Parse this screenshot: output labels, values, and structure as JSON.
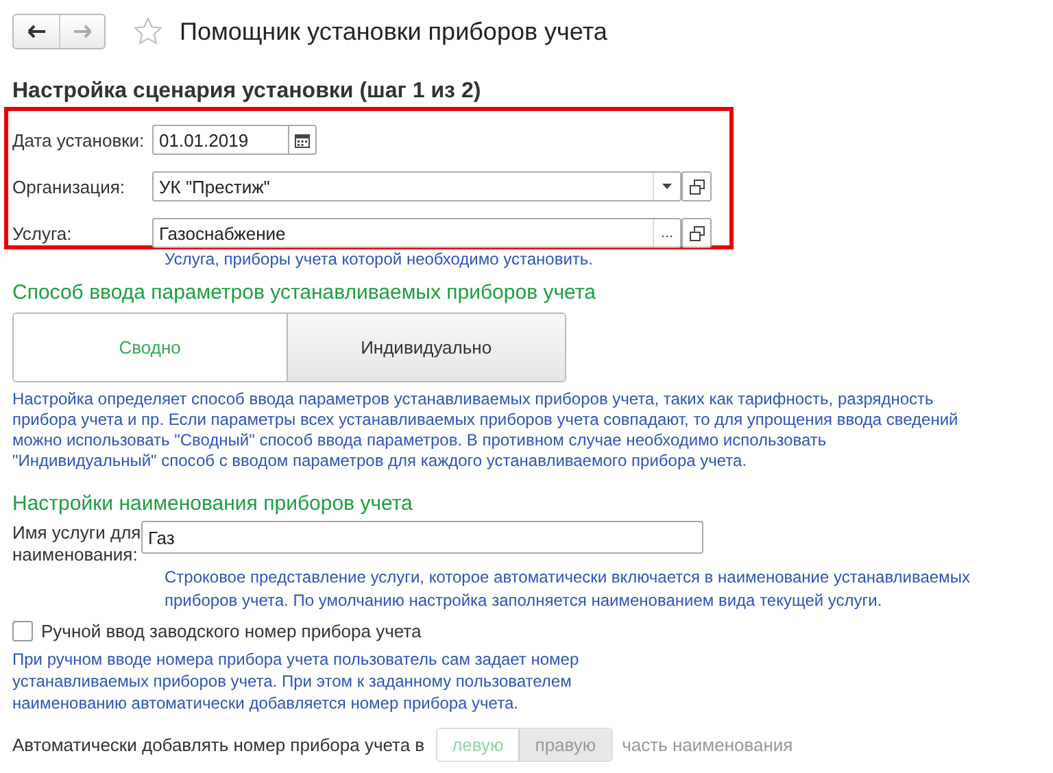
{
  "toolbar": {
    "back": {
      "disabled": false
    },
    "forward": {
      "disabled": true
    },
    "favorite": false,
    "title": "Помощник установки приборов учета"
  },
  "step_heading": "Настройка сценария установки (шаг 1 из 2)",
  "fields": [
    {
      "kind": "date",
      "label": "Дата установки:",
      "value": "01.01.2019"
    },
    {
      "kind": "select",
      "label": "Организация:",
      "value": "УК \"Престиж\""
    },
    {
      "kind": "choice",
      "label": "Услуга:",
      "value": "Газоснабжение",
      "choice_glyph": "..."
    }
  ],
  "service_hint": "Услуга, приборы учета которой необходимо установить.",
  "input_method": {
    "heading": "Способ ввода параметров устанавливаемых приборов учета",
    "options": [
      {
        "label": "Сводно",
        "selected": true
      },
      {
        "label": "Индивидуально",
        "selected": false
      }
    ],
    "description": "Настройка определяет способ ввода параметров устанавливаемых приборов учета, таких как тарифность, разрядность прибора учета и пр. Если параметры всех устанавливаемых приборов учета совпадают, то для упрощения ввода сведений можно использовать \"Сводный\" способ ввода параметров. В противном случае необходимо использовать \"Индивидуальный\" способ с вводом параметров для каждого устанавливаемого прибора учета."
  },
  "naming": {
    "heading": "Настройки наименования приборов учета",
    "name_label": "Имя услуги для наименования:",
    "name_value": "Газ",
    "name_hint": "Строковое представление услуги, которое автоматически включается в наименование устанавливаемых приборов учета. По умолчанию настройка заполняется наименованием вида текущей услуги.",
    "manual": {
      "label": "Ручной ввод заводского номер прибора учета",
      "checked": false
    },
    "manual_hint": "При ручном вводе номера прибора учета пользователь сам задает номер устанавливаемых приборов учета. При этом к заданному пользователем наименованию автоматически добавляется номер прибора учета.",
    "position": {
      "label": "Автоматически добавлять номер прибора учета в",
      "disabled": true,
      "options": [
        {
          "label": "левую",
          "selected": true
        },
        {
          "label": "правую",
          "selected": false
        }
      ],
      "suffix": "часть наименования"
    }
  }
}
